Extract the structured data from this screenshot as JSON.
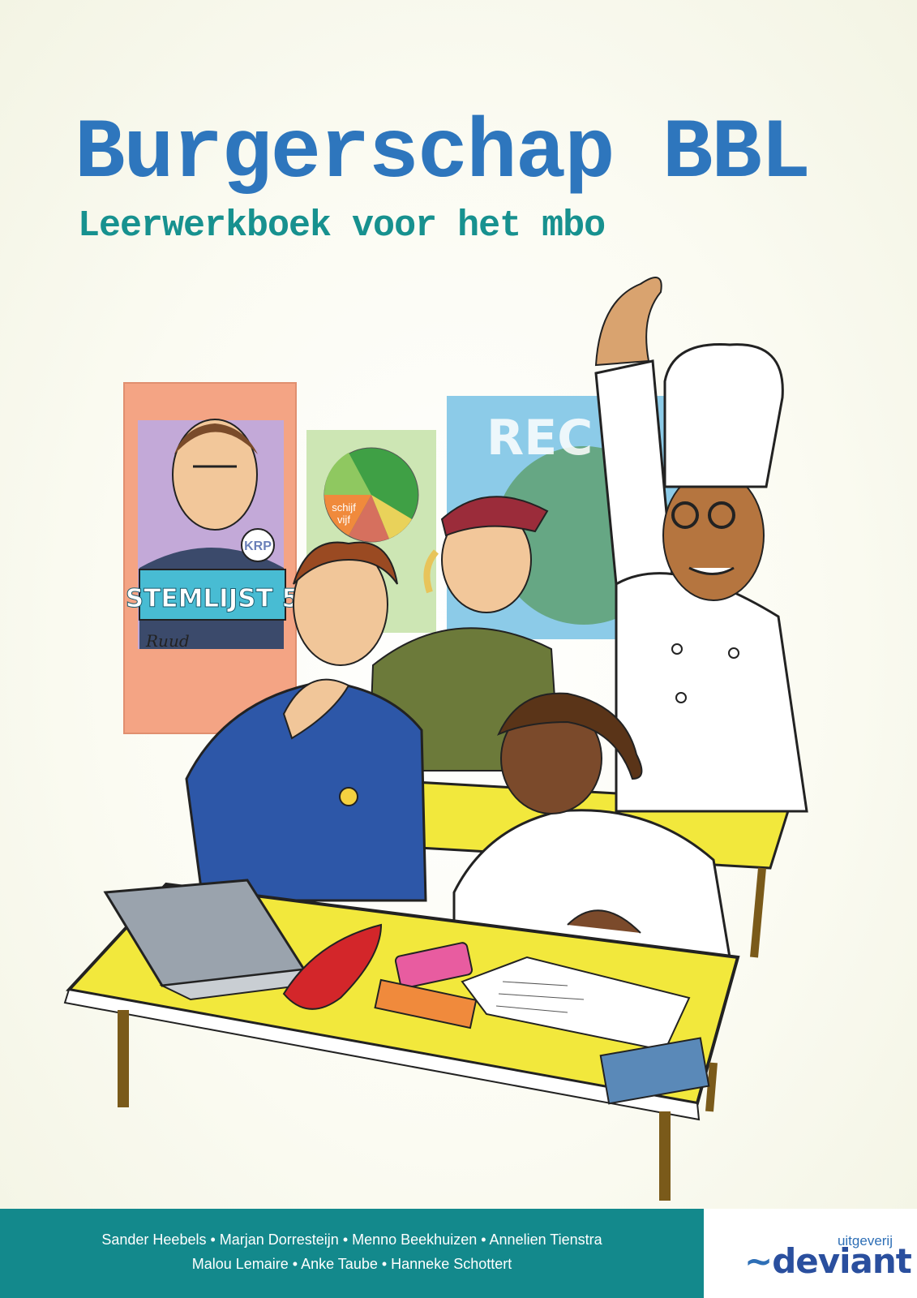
{
  "cover": {
    "title": "Burgerschap BBL",
    "subtitle": "Leerwerkboek voor het mbo"
  },
  "illustration": {
    "poster_party": {
      "badge": "KRP",
      "slogan": "STEMLIJST 5",
      "signature": "Ruud"
    },
    "poster_nutrition": {
      "label_line1": "schijf",
      "label_line2": "vijf"
    },
    "poster_world": {
      "text": "REC"
    }
  },
  "authors": {
    "line1": "Sander Heebels • Marjan Dorresteijn • Menno Beekhuizen • Annelien Tienstra",
    "line2": "Malou Lemaire • Anke Taube • Hanneke Schottert"
  },
  "publisher": {
    "prefix": "uitgeverij",
    "name": "deviant",
    "tilde": "~"
  },
  "colors": {
    "title": "#2e76bd",
    "subtitle": "#17918f",
    "footer": "#13898c",
    "desk": "#f2e83c"
  }
}
